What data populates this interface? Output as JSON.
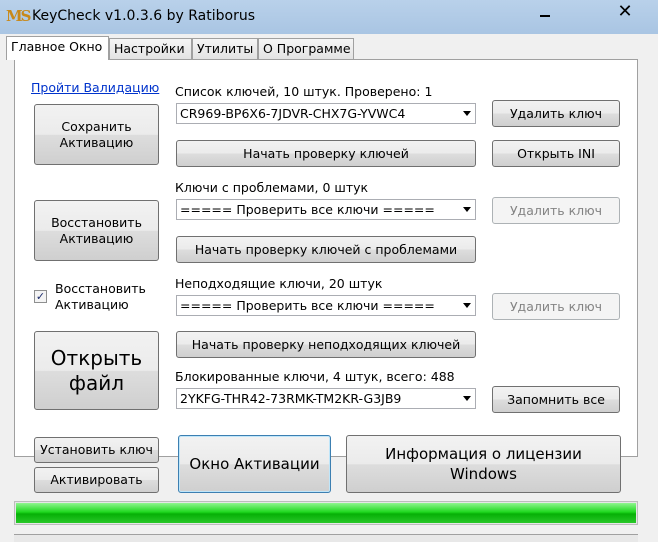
{
  "window": {
    "title": "KeyCheck v1.0.3.6 by Ratiborus",
    "icon_glyph": "MS",
    "close_glyph": "✕"
  },
  "tabs": [
    {
      "label": "Главное Окно",
      "active": true
    },
    {
      "label": "Настройки",
      "active": false
    },
    {
      "label": "Утилиты",
      "active": false
    },
    {
      "label": "О Программе",
      "active": false
    }
  ],
  "left": {
    "validation_link": "Пройти Валидацию",
    "save_activation": "Сохранить Активацию",
    "restore_activation": "Восстановить Активацию",
    "restore_checkbox_label": "Восстановить Активацию",
    "restore_checkbox_checked": true,
    "check_glyph": "✓",
    "open_file": "Открыть файл"
  },
  "keys": {
    "label": "Список ключей, 10 штук.  Проверено: 1",
    "selected": "CR969-BP6X6-7JDVR-CHX7G-YVWC4",
    "start_check": "Начать проверку ключей",
    "delete_key": "Удалить ключ",
    "open_ini": "Открыть INI"
  },
  "problem_keys": {
    "label": "Ключи с проблемами, 0 штук",
    "selected": "===== Проверить все ключи =====",
    "start_check": "Начать проверку ключей с проблемами",
    "delete_key": "Удалить ключ"
  },
  "unsuitable_keys": {
    "label": "Неподходящие ключи, 20 штук",
    "selected": "===== Проверить все ключи =====",
    "start_check": "Начать проверку неподходящих ключей",
    "delete_key": "Удалить ключ"
  },
  "blocked_keys": {
    "label": "Блокированные ключи, 4 штук, всего: 488",
    "selected": "2YKFG-THR42-73RMK-TM2KR-G3JB9",
    "remember_all": "Запомнить все"
  },
  "bottom": {
    "install_key": "Установить ключ",
    "activate": "Активировать",
    "activation_window": "Окно Активации",
    "license_info": "Информация о лицензии Windows"
  },
  "progress": {
    "value": 1.0,
    "color": "#19c919"
  }
}
